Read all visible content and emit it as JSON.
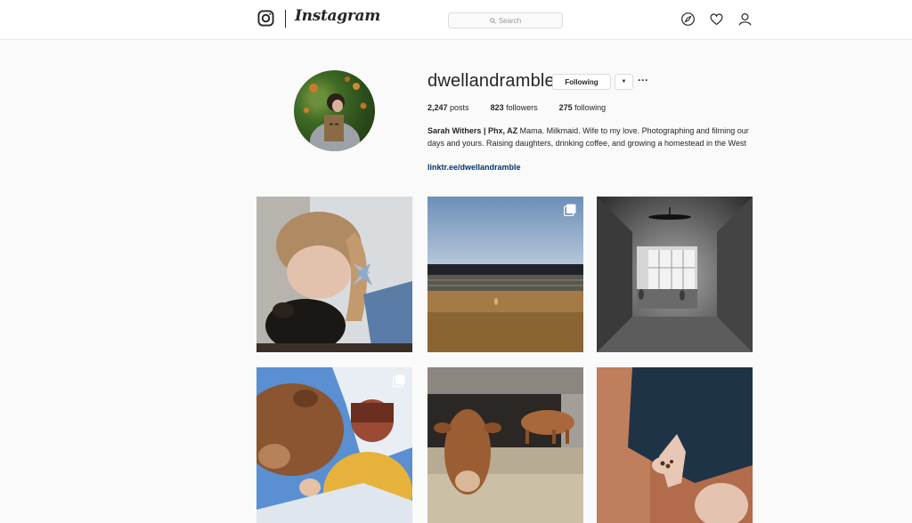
{
  "header": {
    "brand": "Instagram",
    "search_placeholder": "Search",
    "icons": [
      "instagram-glyph-icon",
      "search-icon",
      "compass-icon",
      "heart-icon",
      "profile-icon"
    ]
  },
  "profile": {
    "username": "dwellandramble",
    "following_label": "Following",
    "posts_count": "2,247",
    "posts_label": "posts",
    "followers_count": "823",
    "followers_label": "followers",
    "following_count": "275",
    "following_label_stat": "following",
    "bio_name": "Sarah Withers | Phx, AZ",
    "bio_text": "Mama. Milkmaid. Wife to my love. Photographing and filming our days and yours. Raising daughters, drinking coffee, and growing a homestead in the West",
    "link": "linktr.ee/dwellandramble"
  },
  "posts": [
    {
      "subject": "girl with bow holding black hen",
      "multi": false
    },
    {
      "subject": "toddler in dusty field by barn",
      "multi": true
    },
    {
      "subject": "black and white empty room with ceiling fan",
      "multi": false
    },
    {
      "subject": "child in knit hat hugging cow",
      "multi": true
    },
    {
      "subject": "jersey cows in barn",
      "multi": false
    },
    {
      "subject": "girl hand holding seeds",
      "multi": false
    }
  ],
  "colors": {
    "accent_link": "#003569",
    "border": "#dbdbdb",
    "background": "#fafafa"
  }
}
